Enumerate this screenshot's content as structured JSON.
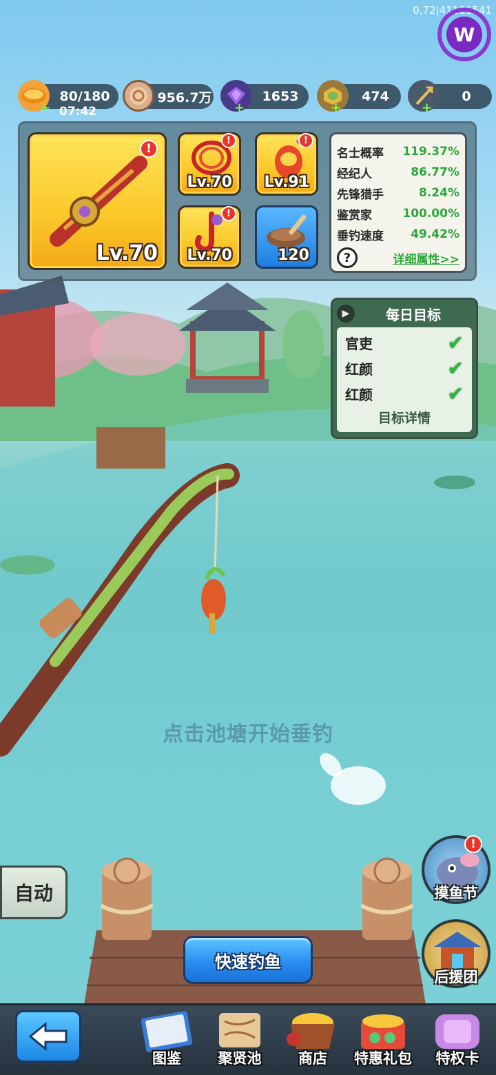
{
  "debug_overlay": "0,72|41181541",
  "resources": {
    "stamina": {
      "value": "80/180",
      "timer": "07:42",
      "icon": "bread-icon"
    },
    "coins": {
      "value": "956.7万",
      "icon": "coin-icon"
    },
    "gems": {
      "value": "1653",
      "icon": "purple-gem-icon"
    },
    "tokens": {
      "value": "474",
      "icon": "gold-token-icon"
    },
    "tridents": {
      "value": "0",
      "icon": "trident-icon"
    }
  },
  "gear": {
    "rod": {
      "level": "Lv.70"
    },
    "line": {
      "level": "Lv.70"
    },
    "float": {
      "level": "Lv.91"
    },
    "hook": {
      "level": "Lv.70"
    },
    "bait": {
      "count": "120"
    },
    "alert": "!"
  },
  "stats": {
    "rows": [
      {
        "name": "名士概率",
        "value": "119.37%"
      },
      {
        "name": "经纪人",
        "value": "86.77%"
      },
      {
        "name": "先锋猎手",
        "value": "8.24%"
      },
      {
        "name": "鉴赏家",
        "value": "100.00%"
      },
      {
        "name": "垂钓速度",
        "value": "49.42%"
      }
    ],
    "help": "?",
    "details_link": "详细属性>>"
  },
  "daily": {
    "title": "每日目标",
    "goals": [
      {
        "label": "官吏",
        "done": true
      },
      {
        "label": "红颜",
        "done": true
      },
      {
        "label": "红颜",
        "done": true
      }
    ],
    "details_button": "目标详情"
  },
  "hint": "点击池塘开始垂钓",
  "auto_button": "自动",
  "quick_fish_button": "快速钓鱼",
  "side_buttons": {
    "festival": "摸鱼节",
    "support": "后援团"
  },
  "nav": {
    "items": [
      {
        "label": "图鉴",
        "icon": "book-icon"
      },
      {
        "label": "聚贤池",
        "icon": "map-scroll-icon"
      },
      {
        "label": "商店",
        "icon": "treasure-basket-icon"
      },
      {
        "label": "特惠礼包",
        "icon": "gift-pack-icon"
      },
      {
        "label": "特权卡",
        "icon": "privilege-card-icon"
      }
    ]
  },
  "colors": {
    "accent_green": "#2ba83a",
    "alert_red": "#e8342a",
    "button_blue": "#2a8ef0",
    "gold_slot": "#fbc82a"
  }
}
